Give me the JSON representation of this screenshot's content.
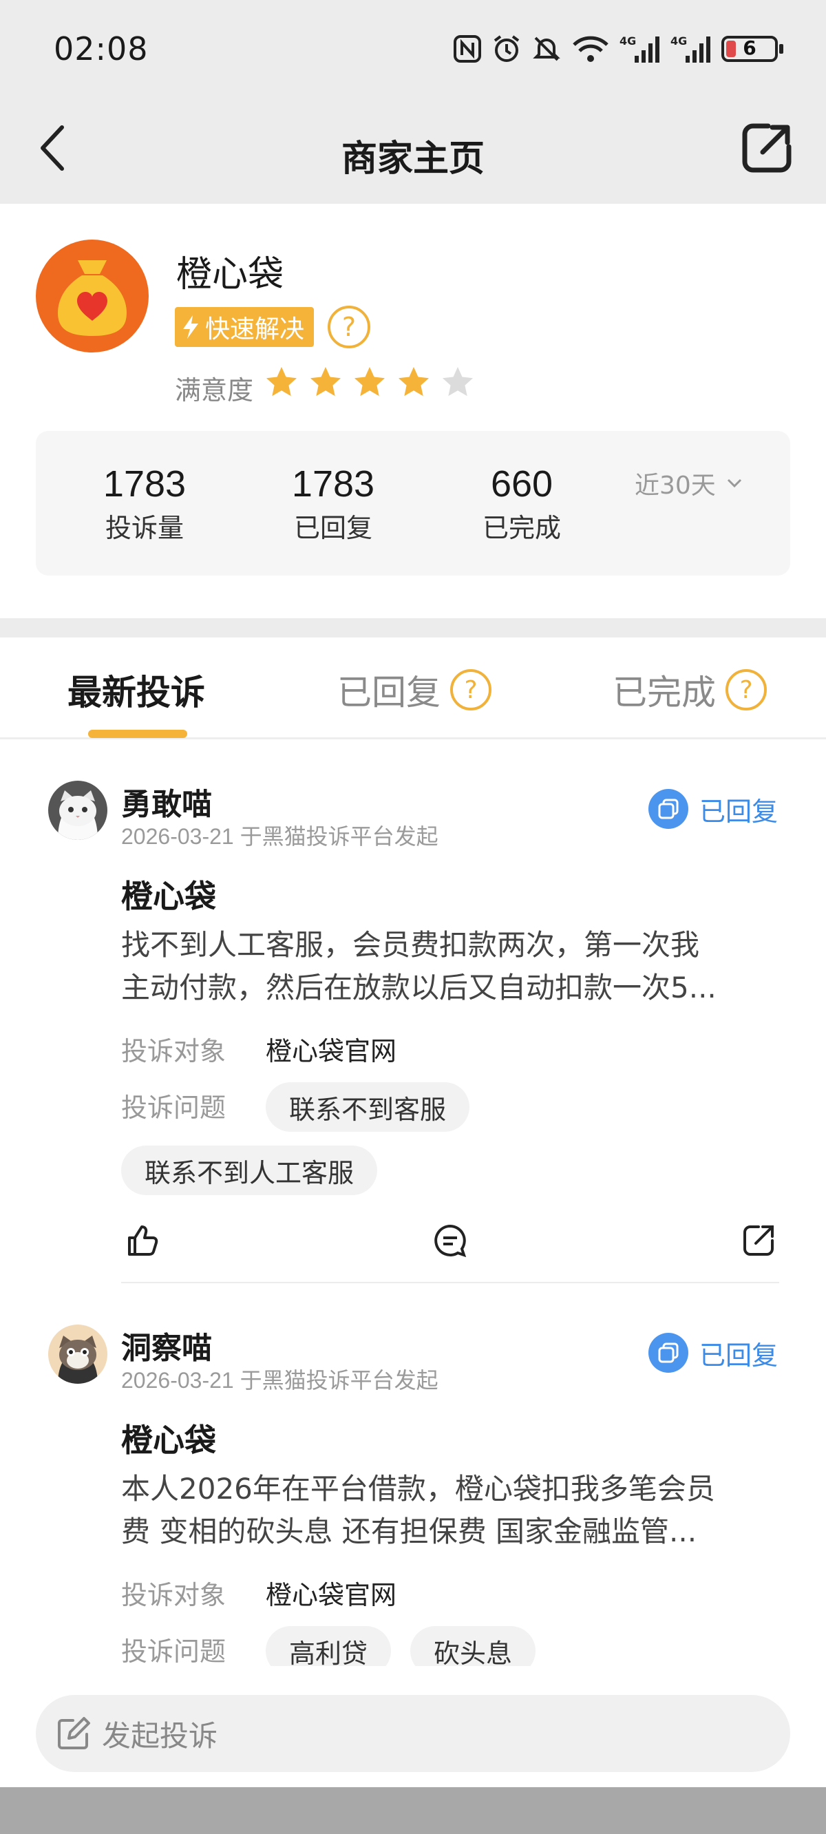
{
  "status_bar": {
    "time": "02:08",
    "battery": "6"
  },
  "nav": {
    "title": "商家主页"
  },
  "merchant": {
    "name": "橙心袋",
    "badge": "快速解决",
    "help": "?",
    "satisfaction_label": "满意度",
    "rating": 4,
    "rating_max": 5,
    "stats": [
      {
        "value": "1783",
        "label": "投诉量"
      },
      {
        "value": "1783",
        "label": "已回复"
      },
      {
        "value": "660",
        "label": "已完成"
      }
    ],
    "period": "近30天"
  },
  "tabs": [
    {
      "label": "最新投诉",
      "active": true
    },
    {
      "label": "已回复",
      "help": "?"
    },
    {
      "label": "已完成",
      "help": "?"
    }
  ],
  "complaints": [
    {
      "user": "勇敢喵",
      "meta": "2026-03-21 于黑猫投诉平台发起",
      "status": "已回复",
      "title": "橙心袋",
      "body_line1": "找不到人工客服，会员费扣款两次，第一次我",
      "body_line2": "主动付款，然后在放款以后又自动扣款一次5...",
      "target_label": "投诉对象",
      "target_value": "橙心袋官网",
      "issue_label": "投诉问题",
      "tags": [
        "联系不到客服",
        "联系不到人工客服"
      ]
    },
    {
      "user": "洞察喵",
      "meta": "2026-03-21 于黑猫投诉平台发起",
      "status": "已回复",
      "title": "橙心袋",
      "body_line1": "本人2026年在平台借款，橙心袋扣我多笔会员",
      "body_line2": "费 变相的砍头息 还有担保费 国家金融监管...",
      "target_label": "投诉对象",
      "target_value": "橙心袋官网",
      "issue_label": "投诉问题",
      "tags": [
        "高利贷",
        "砍头息"
      ]
    }
  ],
  "compose": {
    "placeholder": "发起投诉"
  },
  "colors": {
    "accent": "#f5b33a",
    "status_blue": "#3b8be8",
    "brand_orange": "#ef6a1e"
  }
}
